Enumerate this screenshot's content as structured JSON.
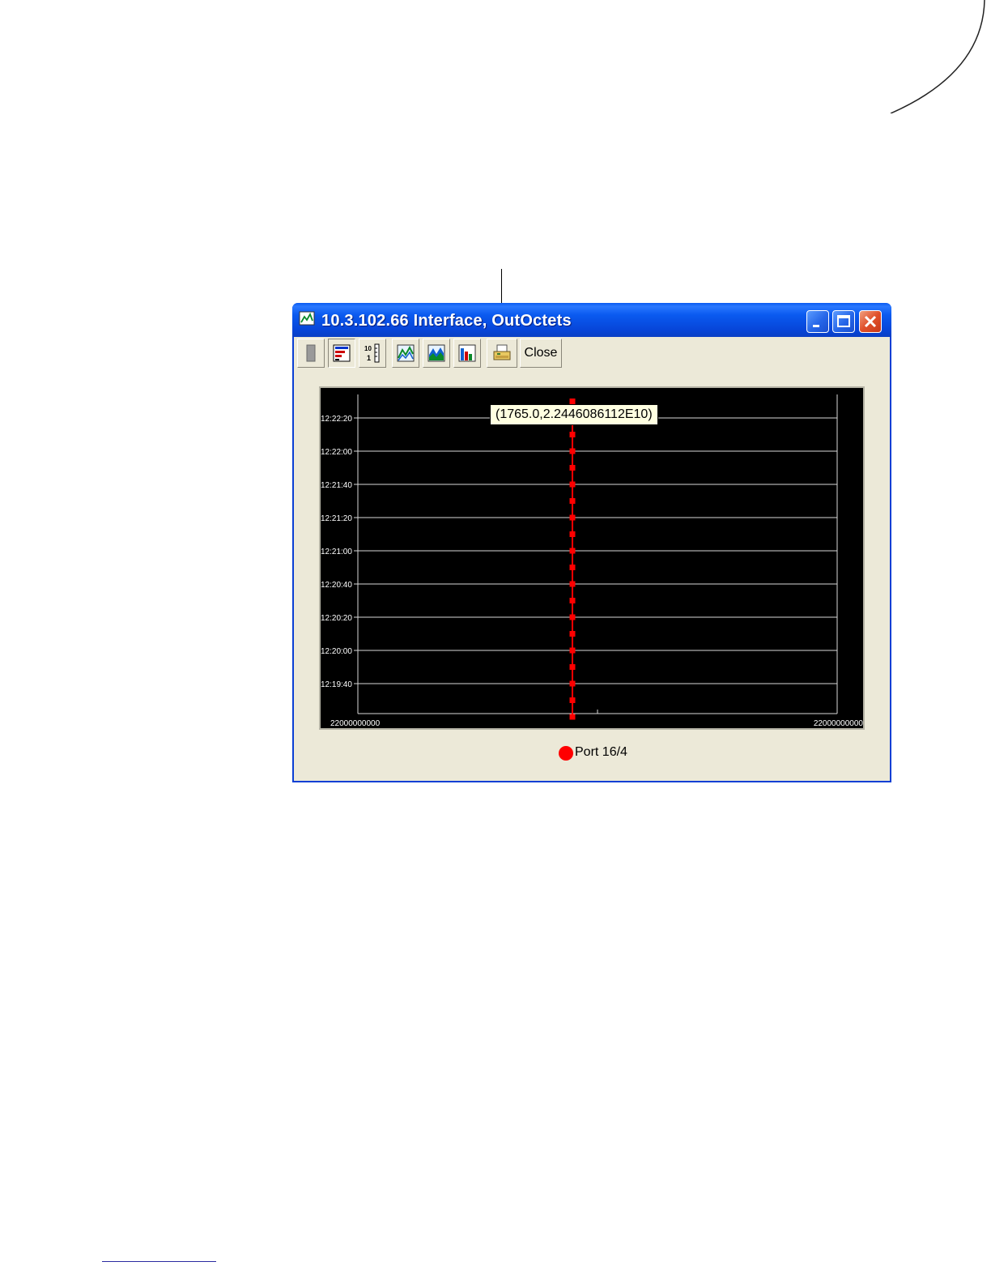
{
  "window": {
    "title": "10.3.102.66 Interface, OutOctets",
    "close_label": "Close"
  },
  "toolbar": {
    "icons": [
      "stop-icon",
      "properties-icon",
      "log-scale-icon",
      "line-chart-icon",
      "area-chart-icon",
      "bar-chart-icon",
      "print-icon"
    ]
  },
  "tooltip": {
    "text": "(1765.0,2.2446086112E10)"
  },
  "legend": {
    "label": "Port 16/4"
  },
  "colors": {
    "series": "#ff0000",
    "plot_background": "#000000",
    "titlebar": "#0a5af0"
  },
  "chart_data": {
    "type": "scatter",
    "series": [
      {
        "name": "Port 16/4",
        "color": "#ff0000",
        "x": [
          22000000000,
          22000000000,
          22000000000,
          22000000000,
          22000000000,
          22000000000,
          22000000000,
          22000000000,
          22000000000,
          22000000000,
          22000000000,
          22000000000,
          22000000000,
          22000000000,
          22000000000,
          22000000000,
          22000000000,
          22000000000,
          22000000000,
          22000000000
        ],
        "y": [
          "12:22:30",
          "12:22:20",
          "12:22:10",
          "12:22:00",
          "12:21:50",
          "12:21:40",
          "12:21:30",
          "12:21:20",
          "12:21:10",
          "12:21:00",
          "12:20:50",
          "12:20:40",
          "12:20:30",
          "12:20:20",
          "12:20:10",
          "12:20:00",
          "12:19:50",
          "12:19:40",
          "12:19:30",
          "12:19:20"
        ]
      }
    ],
    "x_tick_labels": [
      "22000000000",
      "22000000000"
    ],
    "y_tick_labels": [
      "12:22:20",
      "12:22:00",
      "12:21:40",
      "12:21:20",
      "12:21:00",
      "12:20:40",
      "12:20:20",
      "12:20:00",
      "12:19:40"
    ],
    "grid": true,
    "legend_position": "bottom-center"
  }
}
